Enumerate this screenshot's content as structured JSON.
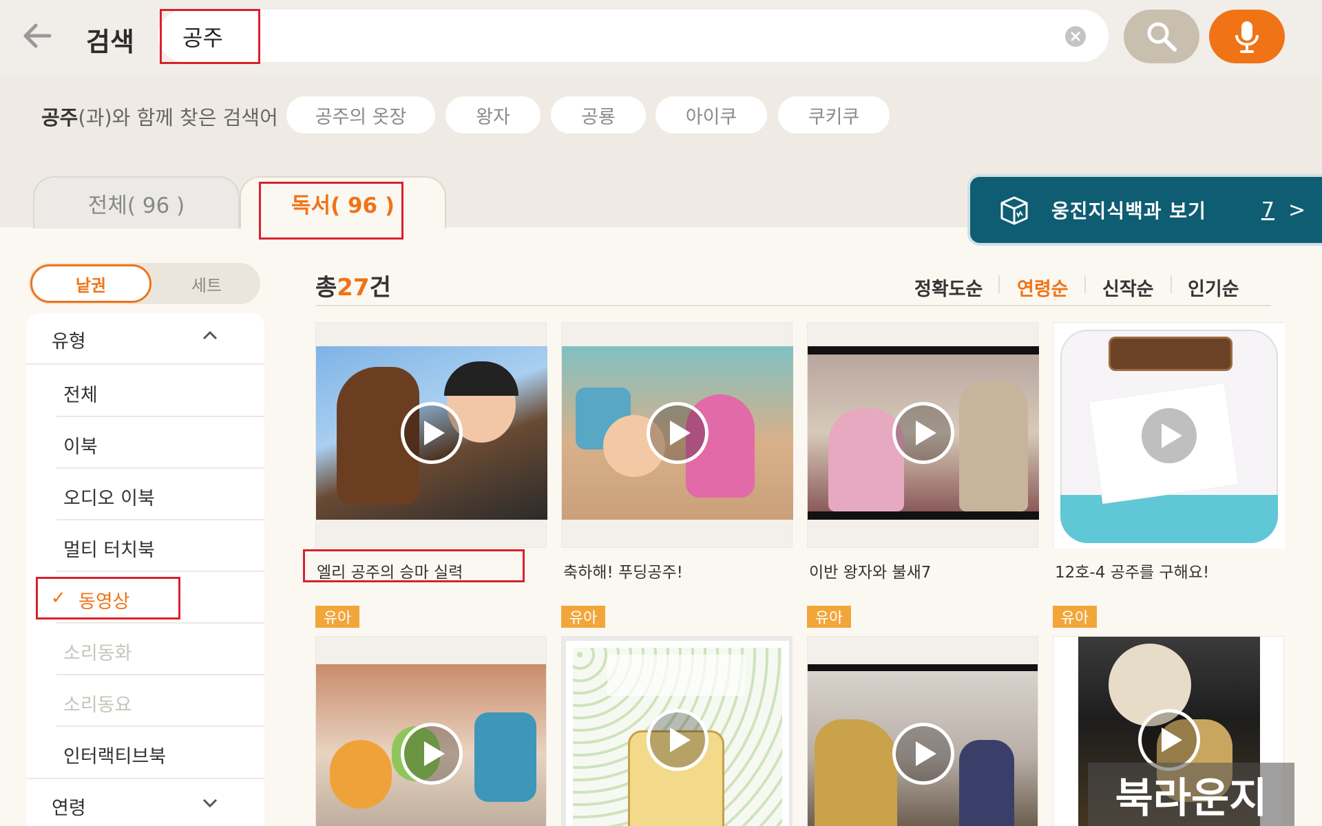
{
  "header": {
    "title": "검색",
    "query": "공주"
  },
  "related": {
    "keyword": "공주",
    "suffix": "(과)와 함께 찾은 검색어",
    "chips": [
      "공주의 옷장",
      "왕자",
      "공룡",
      "아이쿠",
      "쿠키쿠"
    ]
  },
  "tabs": {
    "all": "전체( 96 )",
    "reading": "독서( 96 )"
  },
  "encyclopedia": {
    "label": "웅진지식백과 보기",
    "count": "7",
    "arrow": ">"
  },
  "segment": {
    "single": "낱권",
    "set": "세트"
  },
  "filters": {
    "type_label": "유형",
    "items": [
      "전체",
      "이북",
      "오디오 이북",
      "멀티 터치북",
      "동영상",
      "소리동화",
      "소리동요",
      "인터랙티브북"
    ],
    "age_label": "연령"
  },
  "results": {
    "total_prefix": "총",
    "total_count": "27",
    "total_suffix": "건",
    "sorts": [
      "정확도순",
      "연령순",
      "신작순",
      "인기순"
    ],
    "active_sort": "연령순",
    "row1": [
      {
        "title": "엘리 공주의 승마 실력"
      },
      {
        "title": "축하해! 푸딩공주!"
      },
      {
        "title": "이반 왕자와  불새7"
      },
      {
        "title": "12호-4 공주를 구해요!"
      }
    ],
    "badge": "유아"
  },
  "watermark": "북라운지",
  "colors": {
    "accent": "#f07316",
    "teal": "#0f5d72",
    "highlight": "#d9202b"
  }
}
